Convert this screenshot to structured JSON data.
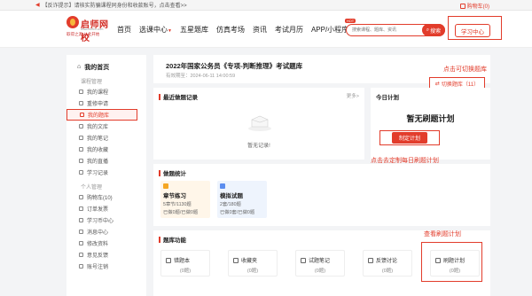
{
  "notice": {
    "text": "【反诈提示】请核实防骗课程同身份和收款账号，点击查看>>",
    "cart": "购物车(0)"
  },
  "header": {
    "logo_name": "启师网校",
    "logo_url": "www.eoffcn.com",
    "logo_slogan": "取得之源 从此开始",
    "nav": [
      "首页",
      "选课中心",
      "五星题库",
      "仿真考场",
      "资讯",
      "考试月历",
      "APP/小程序"
    ],
    "nav_hot_badge": "HOT",
    "search_placeholder": "搜索课程、题库、资讯",
    "search_button": "搜索",
    "study_center": "学习中心"
  },
  "sidebar": {
    "home": "我的首页",
    "groups": [
      {
        "title": "课程管理",
        "items": [
          "我的课程",
          "重修申请",
          "我的题库",
          "我的文库",
          "我的笔记",
          "我的收藏",
          "我的直播",
          "学习记录"
        ]
      },
      {
        "title": "个人管理",
        "items": [
          "购物车(10)",
          "订单发票",
          "学习币中心",
          "消息中心",
          "修改资料",
          "意见反馈",
          "账号注销"
        ]
      }
    ],
    "active_item": "我的题库"
  },
  "exam": {
    "title": "2022年国家公务员《专项-判断推理》考试题库",
    "date": "有效期至：2024-06-11 14:00:59",
    "switch_button": "切换题库（11）",
    "switch_hint": "点击可切换题库"
  },
  "records": {
    "title": "最近做题记录",
    "more": "更多>",
    "empty": "暂无记录!"
  },
  "plan": {
    "title": "今日计划",
    "empty": "暂无刷题计划",
    "button": "制定计划",
    "hint": "点击去定制每日刷题计划"
  },
  "stats": {
    "title": "做题统计",
    "cards": [
      {
        "name": "章节练习",
        "line1": "5章节/1130题",
        "line2": "已做0题/已做0题"
      },
      {
        "name": "模拟试题",
        "line1": "2套/180题",
        "line2": "已做0套/已做0题"
      }
    ]
  },
  "features": {
    "title": "题库功能",
    "hint": "查看刷题计划",
    "cards": [
      {
        "name": "错题本",
        "count": "(0题)"
      },
      {
        "name": "收藏夹",
        "count": "(0题)"
      },
      {
        "name": "试题笔记",
        "count": "(0题)"
      },
      {
        "name": "反馈讨论",
        "count": "(0题)"
      },
      {
        "name": "刷题计划",
        "count": "(0题)"
      }
    ]
  },
  "colors": {
    "accent": "#e23c2b",
    "bg": "#f3f4f6"
  }
}
